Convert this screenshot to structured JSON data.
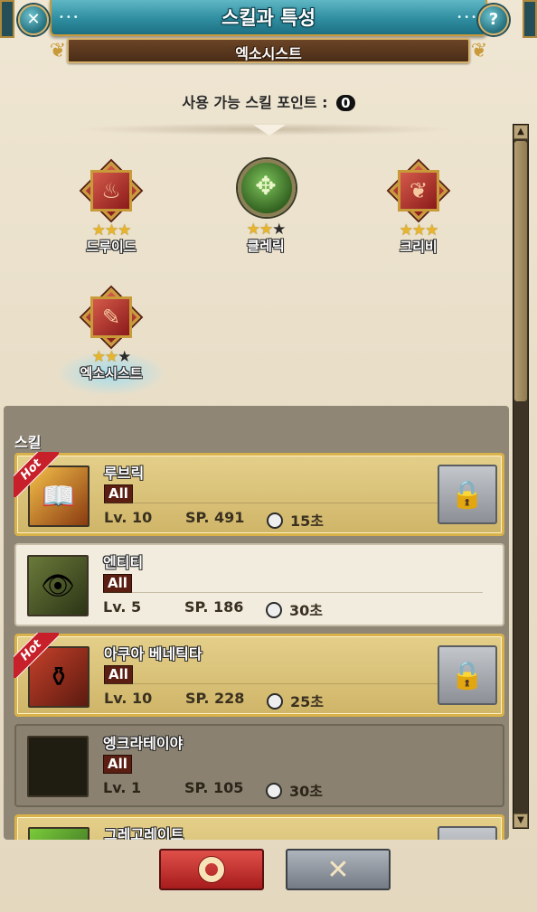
{
  "header": {
    "title": "스킬과 특성",
    "subtitle": "엑소시스트",
    "close_icon": "close-icon",
    "help_icon": "?"
  },
  "skill_points": {
    "label": "사용 가능 스킬 포인트 :",
    "value": "0"
  },
  "classes": [
    {
      "name": "드루이드",
      "stars": 3,
      "max_stars": 3,
      "icon": "druid-emblem-icon"
    },
    {
      "name": "클레릭",
      "stars": 2,
      "max_stars": 3,
      "icon": "cleric-emblem-icon"
    },
    {
      "name": "크리비",
      "stars": 3,
      "max_stars": 3,
      "icon": "krivi-emblem-icon"
    },
    {
      "name": "엑소시스트",
      "stars": 2,
      "max_stars": 3,
      "icon": "exorcist-emblem-icon",
      "selected": true
    }
  ],
  "skills_panel": {
    "title": "스킬",
    "items": [
      {
        "name": "루브릭",
        "tag": "All",
        "lv": "Lv. 10",
        "sp": "SP. 491",
        "cd": "15초",
        "hot": true,
        "locked": true
      },
      {
        "name": "엔티티",
        "tag": "All",
        "lv": "Lv. 5",
        "sp": "SP. 186",
        "cd": "30초",
        "hot": false,
        "locked": false
      },
      {
        "name": "아쿠아 베네틱타",
        "tag": "All",
        "lv": "Lv. 10",
        "sp": "SP. 228",
        "cd": "25초",
        "hot": true,
        "locked": true
      },
      {
        "name": "엥크라테이야",
        "tag": "All",
        "lv": "Lv. 1",
        "sp": "SP. 105",
        "cd": "30초",
        "hot": false,
        "locked": false
      },
      {
        "name": "그레고레이트",
        "tag": "",
        "lv": "",
        "sp": "",
        "cd": "",
        "hot": true,
        "locked": true
      }
    ],
    "hot_label": "Hot"
  },
  "buttons": {
    "ok_icon": "confirm-icon",
    "cancel_label": "✕"
  },
  "colors": {
    "title_bar": "#2f8ea0",
    "hot_ribbon": "#c7202a",
    "star": "#e8b52a",
    "ok_button": "#c23030",
    "cancel_button": "#8e959d"
  }
}
